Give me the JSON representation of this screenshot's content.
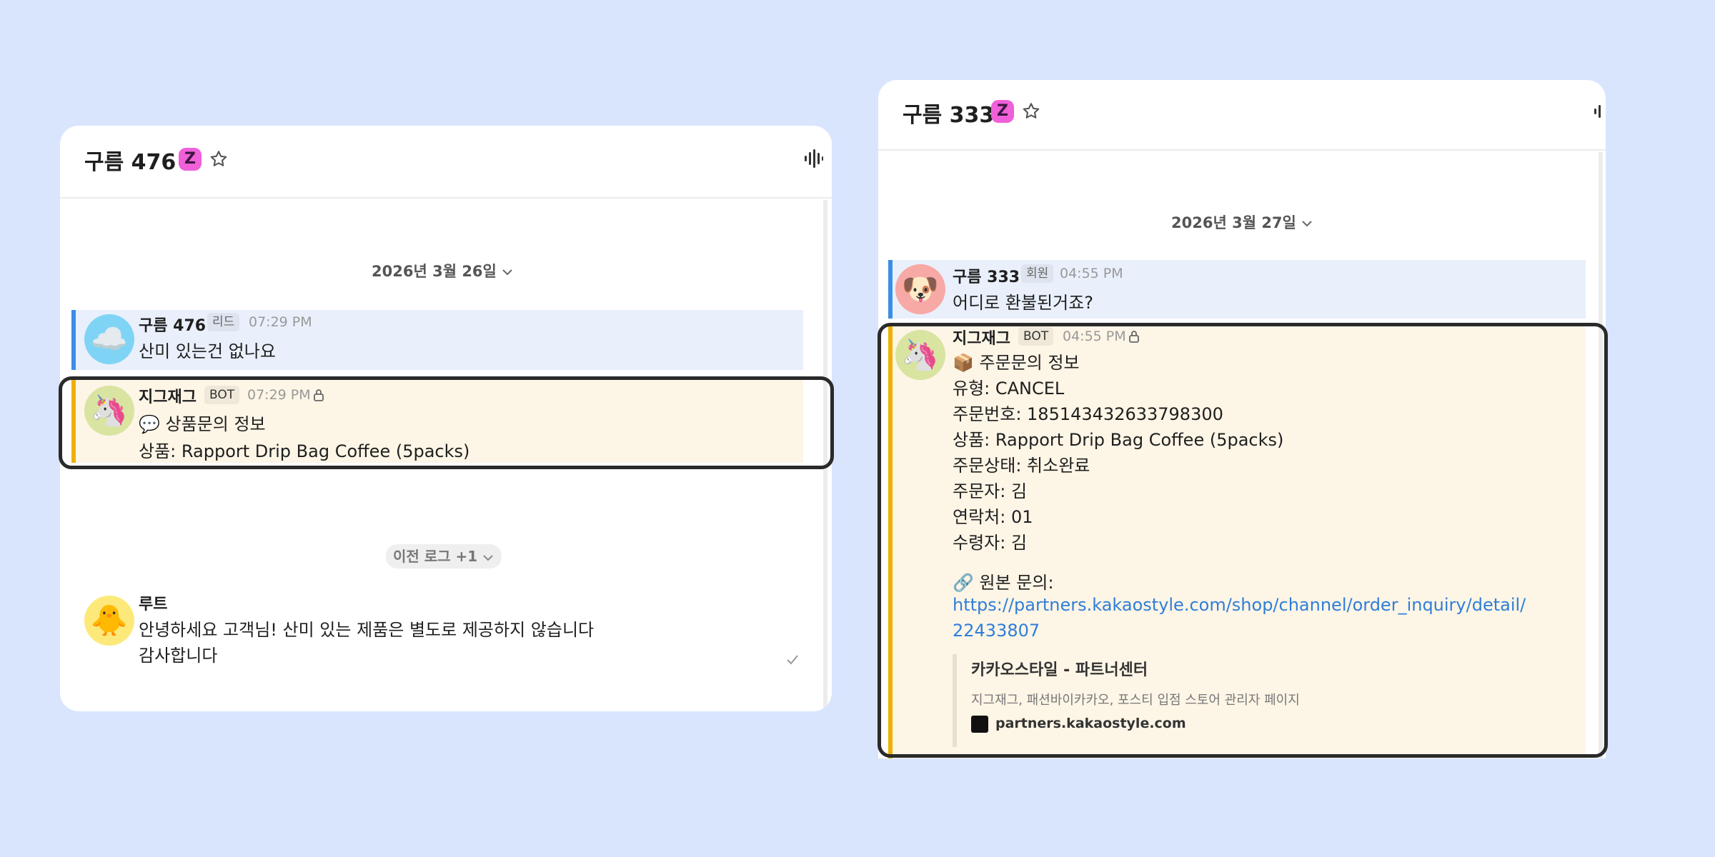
{
  "left": {
    "channel_title": "구름 476",
    "z_badge": "Z",
    "date": "2026년 3월 26일",
    "messages": [
      {
        "author": "구름 476",
        "role": "리드",
        "time": "07:29 PM",
        "avatar": "☁️",
        "lines": [
          "산미 있는건 없나요"
        ]
      },
      {
        "author": "지그재그",
        "role": "BOT",
        "time": "07:29 PM",
        "avatar": "🦄",
        "lines": [
          "💬 상품문의 정보",
          "상품: Rapport Drip Bag Coffee (5packs)"
        ]
      }
    ],
    "prev_log": "이전 로그 +1",
    "reply": {
      "author": "루트",
      "avatar": "🐥",
      "lines": [
        "안녕하세요 고객님! 산미 있는 제품은 별도로 제공하지 않습니다",
        "감사합니다"
      ]
    }
  },
  "right": {
    "channel_title": "구름 333",
    "z_badge": "Z",
    "date": "2026년 3월 27일",
    "member_msg": {
      "author": "구름 333",
      "role": "회원",
      "time": "04:55 PM",
      "avatar": "🐶",
      "lines": [
        "어디로 환불된거죠?"
      ]
    },
    "bot_msg": {
      "author": "지그재그",
      "role": "BOT",
      "time": "04:55 PM",
      "avatar": "🦄",
      "lines": [
        "📦 주문문의 정보",
        "유형: CANCEL",
        "주문번호: 185143432633798300",
        "상품: Rapport Drip Bag Coffee (5packs)",
        "주문상태: 취소완료",
        "주문자: 김",
        "연락처: 01",
        "수령자: 김"
      ],
      "origin_label": "🔗 원본 문의:",
      "link_lines": [
        "https://partners.kakaostyle.com/shop/channel/order_inquiry/detail/",
        "22433807"
      ],
      "preview": {
        "title": "카카오스타일 - 파트너센터",
        "description": "지그재그, 패션바이카카오, 포스티 입점 스토어 관리자 페이지",
        "domain": "partners.kakaostyle.com"
      }
    }
  },
  "colors": {
    "background": "#d9e5fd",
    "lead_bar": "#3a8ee6",
    "bot_bar": "#f0b000",
    "link": "#2f7ed8",
    "z_badge": "#f060d8"
  },
  "icons": [
    "star-icon",
    "audio-wave-icon",
    "chevron-down-icon",
    "lock-icon",
    "check-icon"
  ]
}
